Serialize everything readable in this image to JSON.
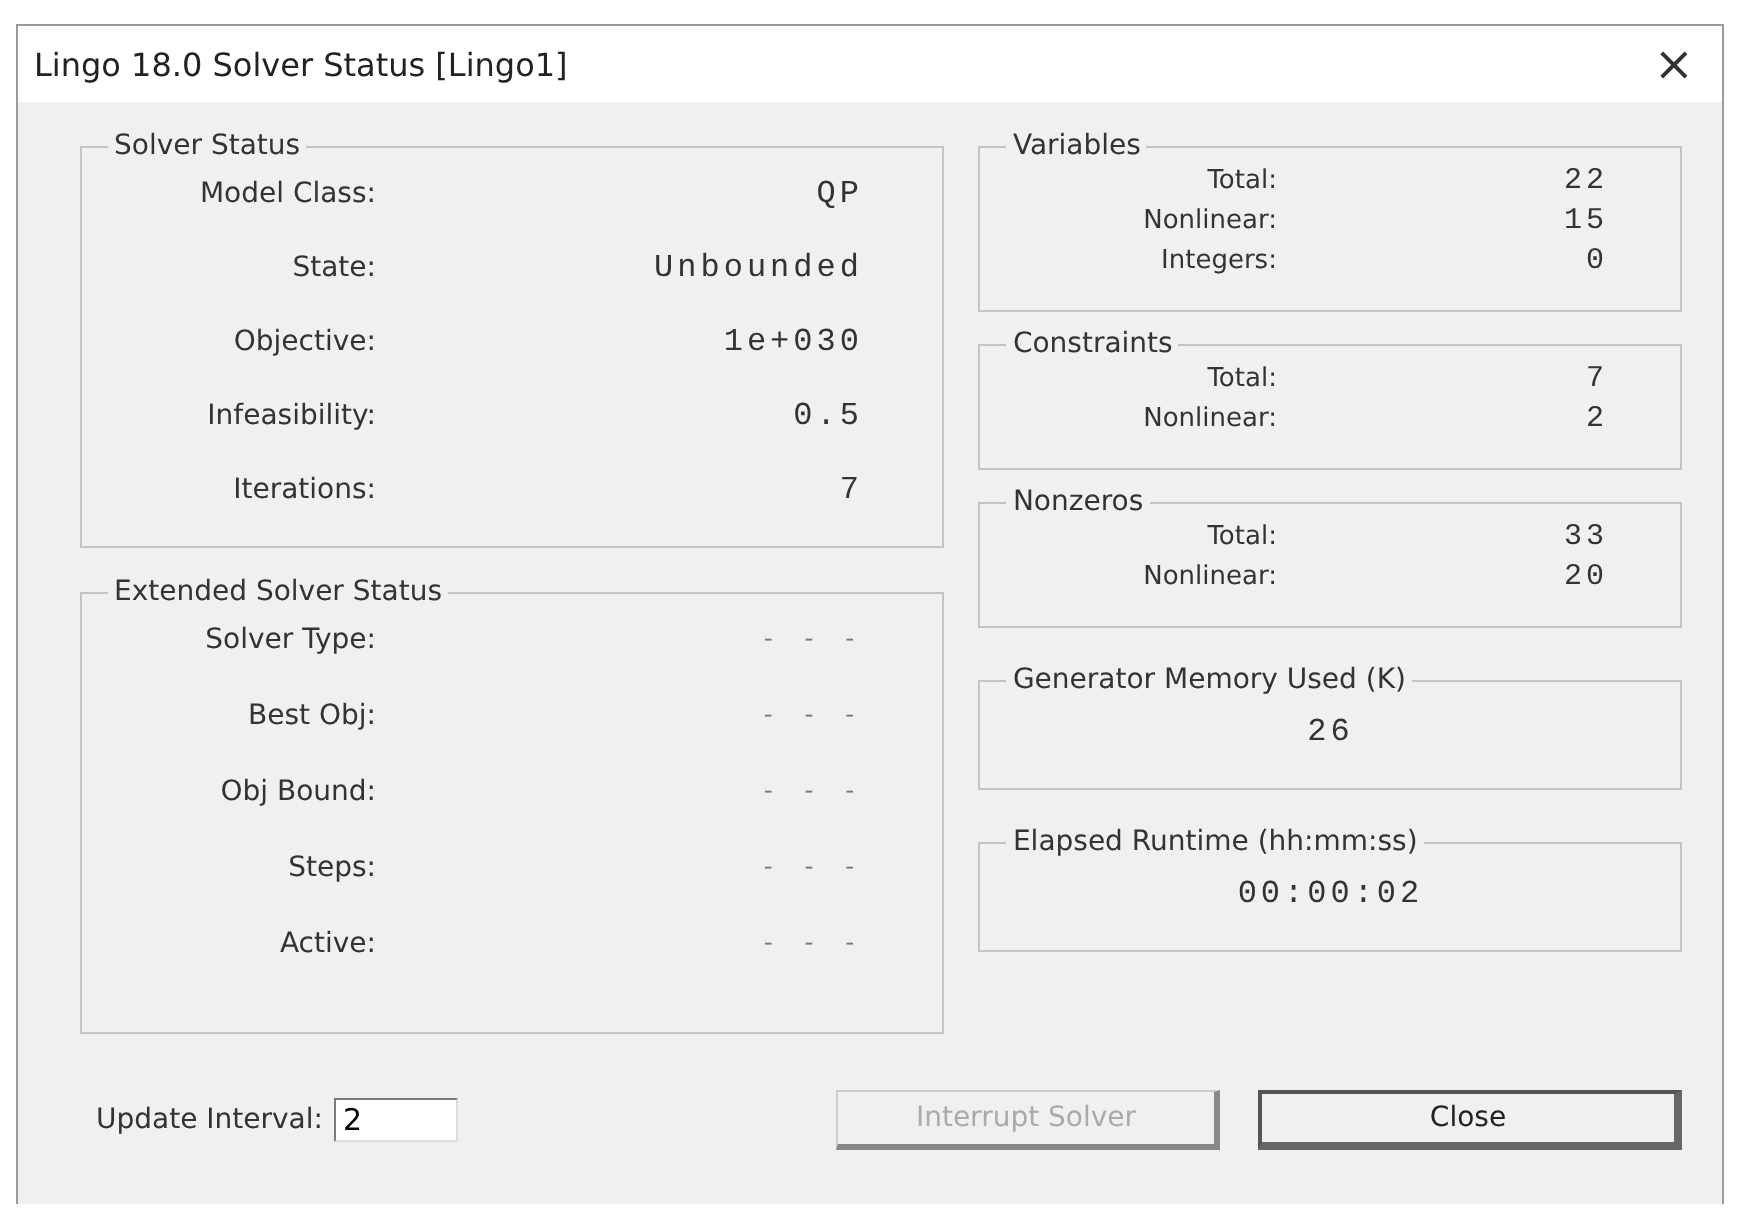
{
  "window": {
    "title": "Lingo 18.0 Solver Status [Lingo1]",
    "close": "×"
  },
  "solver_status": {
    "title": "Solver Status",
    "rows": [
      {
        "label": "Model Class:",
        "value": "QP"
      },
      {
        "label": "State:",
        "value": "Unbounded"
      },
      {
        "label": "Objective:",
        "value": "1e+030"
      },
      {
        "label": "Infeasibility:",
        "value": "0.5"
      },
      {
        "label": "Iterations:",
        "value": "7"
      }
    ]
  },
  "extended_solver_status": {
    "title": "Extended Solver Status",
    "rows": [
      {
        "label": "Solver Type:",
        "value": "- - -"
      },
      {
        "label": "Best Obj:",
        "value": "- - -"
      },
      {
        "label": "Obj Bound:",
        "value": "- - -"
      },
      {
        "label": "Steps:",
        "value": "- - -"
      },
      {
        "label": "Active:",
        "value": "- - -"
      }
    ]
  },
  "counts": [
    {
      "title": "Variables",
      "rows": [
        {
          "label": "Total:",
          "value": "22"
        },
        {
          "label": "Nonlinear:",
          "value": "15"
        },
        {
          "label": "Integers:",
          "value": "0"
        }
      ]
    },
    {
      "title": "Constraints",
      "rows": [
        {
          "label": "Total:",
          "value": "7"
        },
        {
          "label": "Nonlinear:",
          "value": "2"
        }
      ]
    },
    {
      "title": "Nonzeros",
      "rows": [
        {
          "label": "Total:",
          "value": "33"
        },
        {
          "label": "Nonlinear:",
          "value": "20"
        }
      ]
    }
  ],
  "readouts": [
    {
      "title": "Generator Memory Used (K)",
      "value": "26"
    },
    {
      "title": "Elapsed Runtime (hh:mm:ss)",
      "value": "00:00:02"
    }
  ],
  "update_interval": {
    "label": "Update Interval:",
    "value": "2"
  },
  "buttons": [
    {
      "label": "Interrupt Solver",
      "disabled": true,
      "default": false
    },
    {
      "label": "Close",
      "disabled": false,
      "default": true
    }
  ]
}
